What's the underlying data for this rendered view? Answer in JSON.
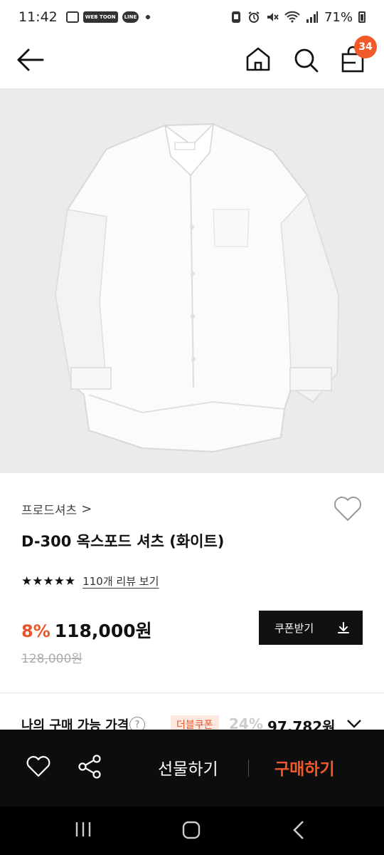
{
  "status_bar": {
    "time": "11:42",
    "app_icons": [
      "gallery-icon",
      "webtoon-icon",
      "line-icon"
    ],
    "webtoon_label": "WEB TOON",
    "line_label": "LINE",
    "battery": "71%"
  },
  "nav": {
    "cart_count": "34"
  },
  "product": {
    "brand": "프로드셔츠",
    "brand_chevron": ">",
    "title": "D-300 옥스포드 셔츠 (화이트)",
    "stars": "★★★★★",
    "rating": 5,
    "review_link": "110개 리뷰 보기",
    "discount": "8%",
    "price": "118,000원",
    "original_price": "128,000원",
    "coupon_button": "쿠폰받기"
  },
  "my_price": {
    "label": "나의 구매 가능 가격",
    "help": "?",
    "tag": "더블쿠폰",
    "rate": "24%",
    "price": "97,782원"
  },
  "action_bar": {
    "gift_label": "선물하기",
    "buy_label": "구매하기"
  },
  "colors": {
    "accent": "#f2582a",
    "badge": "#f25a2a",
    "action_bar_bg": "#0d0d0d",
    "hero_bg": "#ebebeb"
  }
}
